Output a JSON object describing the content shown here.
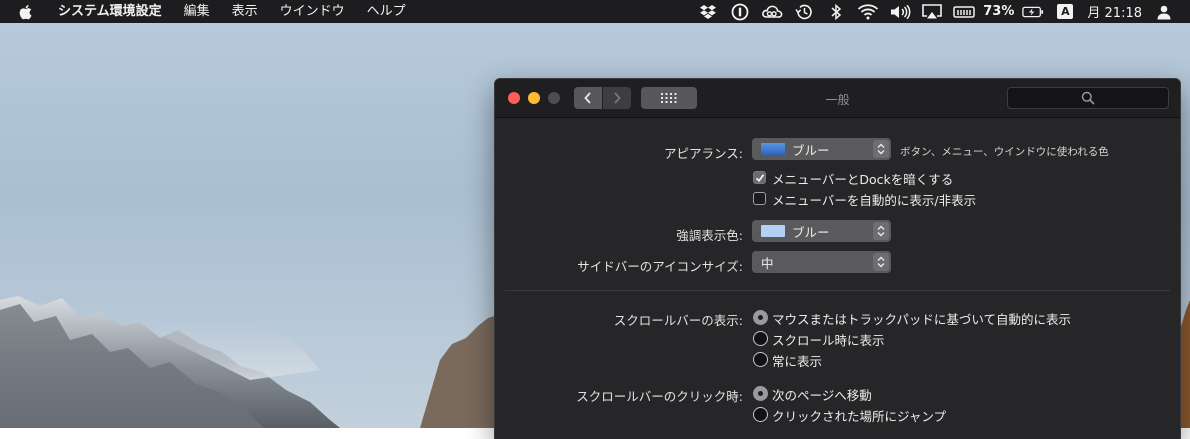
{
  "menubar": {
    "apple_icon": "apple-logo-icon",
    "app_name": "システム環境設定",
    "menus": [
      "編集",
      "表示",
      "ウインドウ",
      "ヘルプ"
    ],
    "battery_percent": "73%",
    "input_source": "A",
    "clock": "月 21:18"
  },
  "window": {
    "title": "一般",
    "appearance": {
      "label": "アピアランス:",
      "value": "ブルー",
      "swatch_color": "#3f7fd4",
      "note": "ボタン、メニュー、ウインドウに使われる色"
    },
    "dark_menu": {
      "label": "メニューバーとDockを暗くする",
      "checked": true
    },
    "auto_hide": {
      "label": "メニューバーを自動的に表示/非表示",
      "checked": false
    },
    "highlight": {
      "label": "強調表示色:",
      "value": "ブルー",
      "swatch_color": "#b3d1f3"
    },
    "sidebar_icon_size": {
      "label": "サイドバーのアイコンサイズ:",
      "value": "中"
    },
    "scroll_show": {
      "label": "スクロールバーの表示:",
      "options": [
        "マウスまたはトラックパッドに基づいて自動的に表示",
        "スクロール時に表示",
        "常に表示"
      ],
      "selected": 0
    },
    "scroll_click": {
      "label": "スクロールバーのクリック時:",
      "options": [
        "次のページへ移動",
        "クリックされた場所にジャンプ"
      ],
      "selected": 0
    }
  }
}
